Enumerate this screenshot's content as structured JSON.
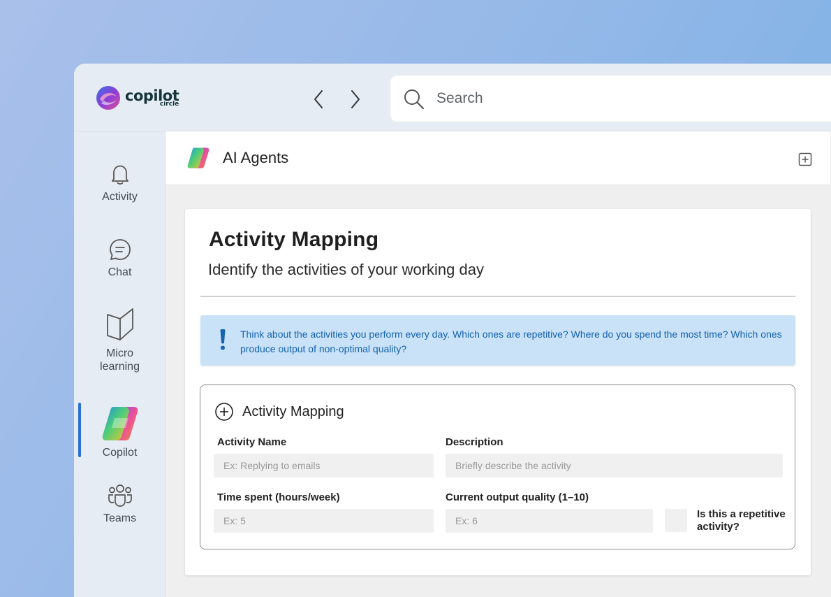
{
  "brand": {
    "name": "copilot",
    "sub": "circle"
  },
  "search": {
    "placeholder": "Search"
  },
  "sidebar": {
    "items": [
      {
        "label": "Activity"
      },
      {
        "label": "Chat"
      },
      {
        "label": "Micro\nlearning"
      },
      {
        "label": "Copilot"
      },
      {
        "label": "Teams"
      }
    ],
    "active_item": "Copilot"
  },
  "header": {
    "title": "AI Agents"
  },
  "card": {
    "title": "Activity Mapping",
    "subtitle": "Identify the activities of your working day",
    "info": "Think about the activities you perform every day. Which ones are repetitive? Where do you spend the most time? Which ones produce output of non-optimal quality?"
  },
  "form": {
    "title": "Activity Mapping",
    "fields": {
      "name": {
        "label": "Activity Name",
        "placeholder": "Ex: Replying to emails"
      },
      "description": {
        "label": "Description",
        "placeholder": "Briefly describe the activity"
      },
      "time": {
        "label": "Time spent (hours/week)",
        "placeholder": "Ex: 5"
      },
      "quality": {
        "label": "Current output quality (1–10)",
        "placeholder": "Ex: 6"
      }
    },
    "repetitive_label": "Is this a repetitive activity?",
    "repetitive_checked": false
  },
  "colors": {
    "accent": "#2b6fd6",
    "info_bg": "#c9e2f8",
    "info_text": "#1462b0",
    "brand_text": "#14343a"
  }
}
